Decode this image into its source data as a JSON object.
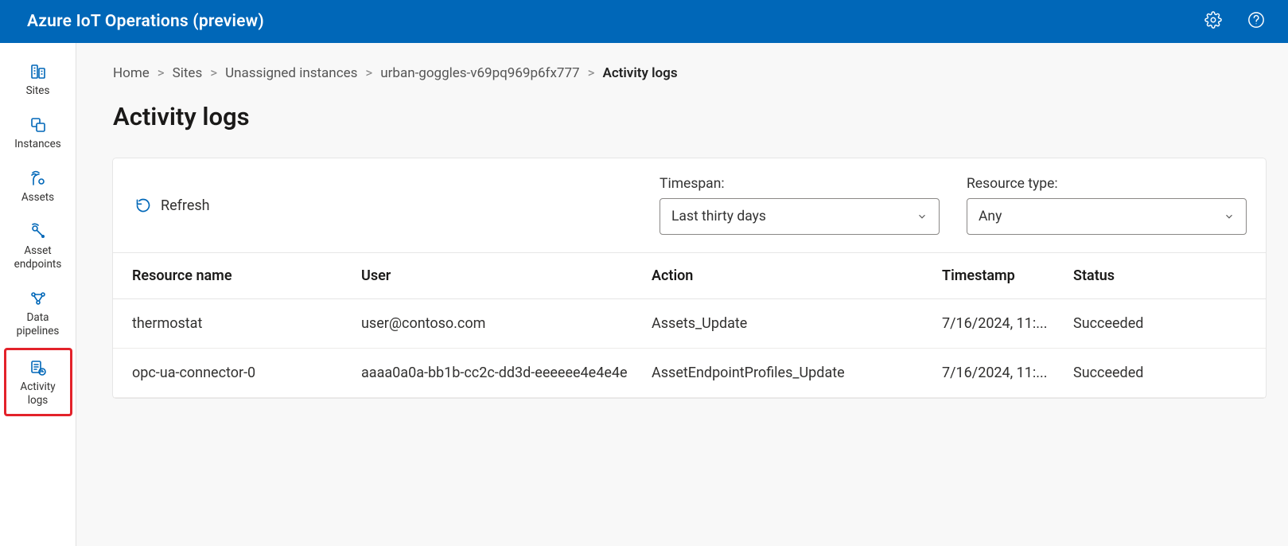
{
  "header": {
    "title": "Azure IoT Operations (preview)"
  },
  "sidenav": {
    "items": [
      {
        "label": "Sites"
      },
      {
        "label": "Instances"
      },
      {
        "label": "Assets"
      },
      {
        "label": "Asset endpoints"
      },
      {
        "label": "Data pipelines"
      },
      {
        "label": "Activity logs"
      }
    ]
  },
  "breadcrumb": {
    "items": [
      {
        "label": "Home"
      },
      {
        "label": "Sites"
      },
      {
        "label": "Unassigned instances"
      },
      {
        "label": "urban-goggles-v69pq969p6fx777"
      }
    ],
    "current": "Activity logs",
    "separator": ">"
  },
  "page": {
    "title": "Activity logs"
  },
  "toolbar": {
    "refresh_label": "Refresh"
  },
  "filters": {
    "timespan": {
      "label": "Timespan:",
      "value": "Last thirty days"
    },
    "resource_type": {
      "label": "Resource type:",
      "value": "Any"
    }
  },
  "table": {
    "columns": {
      "resource_name": "Resource name",
      "user": "User",
      "action": "Action",
      "timestamp": "Timestamp",
      "status": "Status"
    },
    "rows": [
      {
        "resource_name": "thermostat",
        "user": "user@contoso.com",
        "action": "Assets_Update",
        "timestamp": "7/16/2024, 11:...",
        "status": "Succeeded"
      },
      {
        "resource_name": "opc-ua-connector-0",
        "user": "aaaa0a0a-bb1b-cc2c-dd3d-eeeeee4e4e4e",
        "action": "AssetEndpointProfiles_Update",
        "timestamp": "7/16/2024, 11:...",
        "status": "Succeeded"
      }
    ]
  }
}
